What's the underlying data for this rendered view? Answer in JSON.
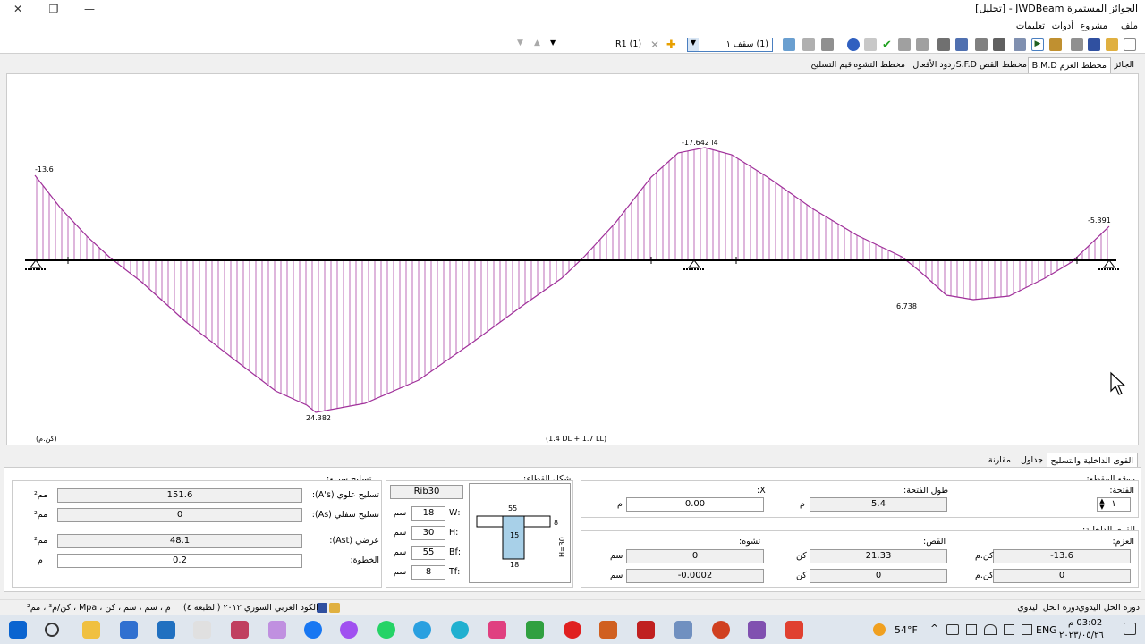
{
  "window": {
    "title": "الجوائز المستمرة JWDBeam - [تحليل]"
  },
  "menu": {
    "items": [
      "ملف",
      "مشروع",
      "أدوات",
      "تعليمات"
    ]
  },
  "toolbar": {
    "span_select": "(1) سقف ١",
    "r_label": "R1 (1)"
  },
  "tabs_top": [
    "الجائز",
    "مخطط العزم B.M.D",
    "مخطط القص S.F.D",
    "ردود الأفعال",
    "مخطط التشوه",
    "قيم التسليح"
  ],
  "chart": {
    "unit_label": "(كن.م)",
    "combo_label": "(1.4 DL + 1.7 LL)",
    "line_color": "#a0309a",
    "labels": [
      "-13.6",
      "-17.642 l4",
      "-5.391",
      "6.738",
      "24.382"
    ]
  },
  "bottom_tabs": [
    "القوى الداخلية والتسليح",
    "جداول",
    "مقارنة"
  ],
  "section_pos": {
    "title": "موقع المقطع:",
    "span_label": "الفتحة:",
    "span_value": "١",
    "length_label": "طول الفتحة:",
    "length_value": "5.4",
    "length_unit": "م",
    "x_label": "X:",
    "x_value": "0.00",
    "x_unit": "م"
  },
  "internal_forces": {
    "title": "القوى الداخلية:",
    "moment_label": "العزم:",
    "shear_label": "القص:",
    "defl_label": "تشوه:",
    "moment_1": "-13.6",
    "moment_1_unit": "كن.م",
    "moment_2": "0",
    "moment_2_unit": "كن.م",
    "shear_1": "21.33",
    "shear_1_unit": "كن",
    "shear_2": "0",
    "shear_2_unit": "كن",
    "defl_1": "0",
    "defl_1_unit": "سم",
    "defl_2": "-0.0002",
    "defl_2_unit": "سم"
  },
  "section_shape": {
    "title": "شكل القطاع:",
    "name": "Rib30",
    "w_label": ":W",
    "w_value": "18",
    "h_label": ":H",
    "h_value": "30",
    "bf_label": ":Bf",
    "bf_value": "55",
    "tf_label": ":Tf",
    "tf_value": "8",
    "unit": "سم",
    "fig_top": "55",
    "fig_mid": "15",
    "fig_bot": "18",
    "fig_tf": "8",
    "fig_h": "H=30"
  },
  "reinforcement": {
    "title": "تسليح سريع:",
    "top_label": "تسليح علوي (A's):",
    "top_value": "151.6",
    "top_unit": "مم²",
    "bot_label": "تسليح سفلي (As):",
    "bot_value": "0",
    "bot_unit": "مم²",
    "trans_label": "عرضي (Ast):",
    "trans_value": "48.1",
    "trans_unit": "مم²",
    "step_label": "الخطوة:",
    "step_value": "0.2",
    "step_unit": "م"
  },
  "statusbar": {
    "right1": "دورة الحل اليدوي",
    "right2": "دورة الحل اليدوي",
    "code": "الكود العربي السوري ٢٠١٢ (الطبعة ٤)",
    "units": "م ، سم ، سم ، كن ، Mpa ، كن/م³ ، مم²"
  },
  "taskbar": {
    "temp": "54°F",
    "lang": "ENG",
    "time": "03:02 م",
    "date": "٢٠٢٣/٠٥/٢٦"
  }
}
